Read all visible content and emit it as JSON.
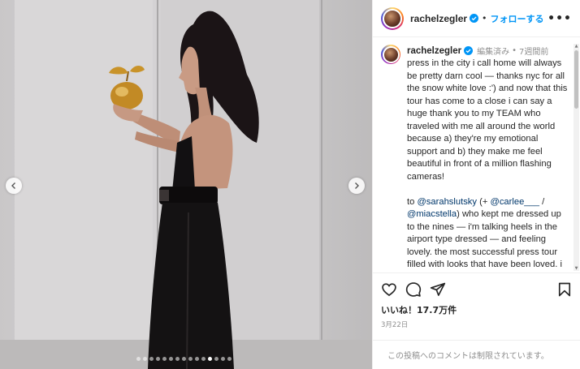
{
  "post": {
    "username": "rachelzegler",
    "separator": "•",
    "follow_label": "フォローする",
    "more_label": "•••"
  },
  "caption": {
    "username": "rachelzegler",
    "edited_label": "編集済み",
    "separator": "•",
    "time_ago": "7週間前",
    "paragraph1": "press in the city i call home will always be pretty darn cool — thanks nyc for all the snow white love :') and now that this tour has come to a close i can say a huge thank you to my TEAM who traveled with me all around the world because a) they're my emotional support and b) they make me feel beautiful in front of a million flashing cameras!",
    "p2_prefix": "to ",
    "mention1": "@sarahslutsky",
    "p2_mid1": " (+ ",
    "mention2": "@carlee___",
    "p2_mid2": " / ",
    "mention3": "@miacstella",
    "p2_rest": ") who kept me dressed up to the nines — i'm talking heels in the airport type dressed — and feeling lovely. the most successful press tour filled with looks that have been loved. i am so thankful."
  },
  "engagement": {
    "likes": "いいね！17.7万件",
    "date": "3月22日"
  },
  "comments": {
    "disabled_text": "この投稿へのコメントは制限されています。"
  },
  "carousel": {
    "slide_count": 15,
    "active_index": 11
  },
  "colors": {
    "accent": "#0095f6",
    "text": "#262626",
    "muted": "#8e8e8e"
  },
  "icons": [
    "heart-icon",
    "comment-icon",
    "share-icon",
    "bookmark-icon",
    "verified-icon",
    "chevron-left-icon",
    "chevron-right-icon",
    "more-icon"
  ]
}
